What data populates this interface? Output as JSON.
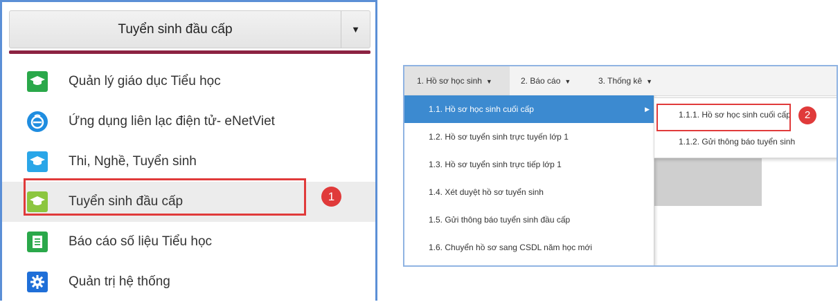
{
  "left": {
    "dropdown": {
      "label": "Tuyển sinh đầu cấp",
      "caret": "▼"
    },
    "items": [
      {
        "label": "Quản lý giáo dục Tiểu học",
        "icon": "graduation-cap-icon",
        "color": "#2aa84a"
      },
      {
        "label": "Ứng dụng liên lạc điện tử- eNetViet",
        "icon": "enetviet-icon",
        "color": "#1f8de0"
      },
      {
        "label": "Thi, Nghề, Tuyển sinh",
        "icon": "graduation-cap-icon",
        "color": "#2aa6e8"
      },
      {
        "label": "Tuyển sinh đầu cấp",
        "icon": "graduation-cap-icon",
        "color": "#8cc63f"
      },
      {
        "label": "Báo cáo số liệu Tiểu học",
        "icon": "document-icon",
        "color": "#2aa84a"
      },
      {
        "label": "Quản trị hệ thống",
        "icon": "gear-icon",
        "color": "#1f6fd8"
      }
    ],
    "step_badge": "1"
  },
  "right": {
    "menubar": [
      {
        "label": "1. Hồ sơ học sinh"
      },
      {
        "label": "2. Báo cáo"
      },
      {
        "label": "3. Thống kê"
      }
    ],
    "submenu": [
      {
        "label": "1.1. Hồ sơ học sinh cuối cấp"
      },
      {
        "label": "1.2. Hồ sơ tuyển sinh trực tuyến lớp 1"
      },
      {
        "label": "1.3. Hồ sơ tuyển sinh trực tiếp lớp 1"
      },
      {
        "label": "1.4. Xét duyệt hồ sơ tuyển sinh"
      },
      {
        "label": "1.5. Gửi thông báo tuyển sinh đầu cấp"
      },
      {
        "label": "1.6. Chuyển hồ sơ sang CSDL năm học mới"
      }
    ],
    "submenu2": [
      {
        "label": "1.1.1. Hồ sơ học sinh cuối cấp"
      },
      {
        "label": "1.1.2. Gửi thông báo tuyển sinh"
      }
    ],
    "step_badge": "2"
  },
  "colors": {
    "accent_blue": "#3c8ad0",
    "highlight_red": "#e03a3a",
    "dropdown_accent": "#8c2342"
  }
}
